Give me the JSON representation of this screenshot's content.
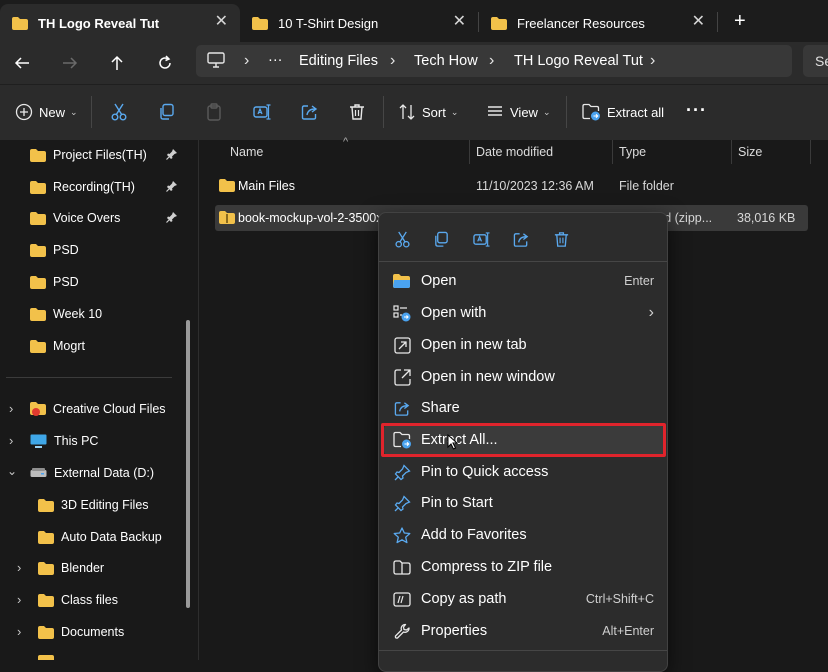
{
  "tabs": [
    {
      "title": "TH Logo Reveal Tut",
      "close": "✕"
    },
    {
      "title": "10 T-Shirt Design",
      "close": "✕"
    },
    {
      "title": "Freelancer Resources",
      "close": "✕"
    }
  ],
  "new_tab": "+",
  "breadcrumb": {
    "more": "···",
    "items": [
      "Editing Files",
      "Tech How",
      "TH Logo Reveal Tut"
    ],
    "separator": "›"
  },
  "search": {
    "placeholder": "Se"
  },
  "commandbar": {
    "new_label": "New",
    "sort_label": "Sort",
    "view_label": "View",
    "extract_all_label": "Extract all",
    "more": "···",
    "dropdown": "⌄"
  },
  "navpane": {
    "quick_access": [
      {
        "label": "Project Files(TH)",
        "pinned": true
      },
      {
        "label": "Recording(TH)",
        "pinned": true
      },
      {
        "label": "Voice Overs",
        "pinned": true
      },
      {
        "label": "PSD",
        "pinned": false
      },
      {
        "label": "PSD",
        "pinned": false
      },
      {
        "label": "Week 10",
        "pinned": false
      },
      {
        "label": "Mogrt",
        "pinned": false
      }
    ],
    "locations": [
      {
        "label": "Creative Cloud Files",
        "icon": "creative-cloud-icon"
      },
      {
        "label": "This PC",
        "icon": "pc-icon"
      },
      {
        "label": "External Data (D:)",
        "icon": "drive-icon"
      }
    ],
    "drive_children": [
      {
        "label": "3D Editing Files",
        "expandable": false
      },
      {
        "label": "Auto Data Backup",
        "expandable": false
      },
      {
        "label": "Blender",
        "expandable": true
      },
      {
        "label": "Class files",
        "expandable": true
      },
      {
        "label": "Documents",
        "expandable": true
      }
    ]
  },
  "filelist": {
    "columns": [
      "Name",
      "Date modified",
      "Type",
      "Size"
    ],
    "rows": [
      {
        "name": "Main Files",
        "date": "11/10/2023 12:36 AM",
        "type": "File folder",
        "size": ""
      },
      {
        "name": "book-mockup-vol-2-3500x",
        "date": "",
        "type": "sed (zipp...",
        "size": "38,016 KB"
      }
    ]
  },
  "context_menu": {
    "items": [
      {
        "label": "Open",
        "shortcut": "Enter",
        "icon": "folder-open-icon"
      },
      {
        "label": "Open with",
        "shortcut": "›",
        "icon": "open-with-icon"
      },
      {
        "label": "Open in new tab",
        "shortcut": "",
        "icon": "new-tab-icon"
      },
      {
        "label": "Open in new window",
        "shortcut": "",
        "icon": "new-window-icon"
      },
      {
        "label": "Share",
        "shortcut": "",
        "icon": "share-icon"
      },
      {
        "label": "Extract All...",
        "shortcut": "",
        "icon": "extract-icon"
      },
      {
        "label": "Pin to Quick access",
        "shortcut": "",
        "icon": "pin-icon"
      },
      {
        "label": "Pin to Start",
        "shortcut": "",
        "icon": "pin-icon"
      },
      {
        "label": "Add to Favorites",
        "shortcut": "",
        "icon": "star-icon"
      },
      {
        "label": "Compress to ZIP file",
        "shortcut": "",
        "icon": "zip-icon"
      },
      {
        "label": "Copy as path",
        "shortcut": "Ctrl+Shift+C",
        "icon": "copy-path-icon"
      },
      {
        "label": "Properties",
        "shortcut": "Alt+Enter",
        "icon": "properties-icon"
      }
    ]
  },
  "colors": {
    "folder": "#f2c14a",
    "highlight_border": "#e0242c",
    "accent_blue": "#4aa3f0"
  }
}
